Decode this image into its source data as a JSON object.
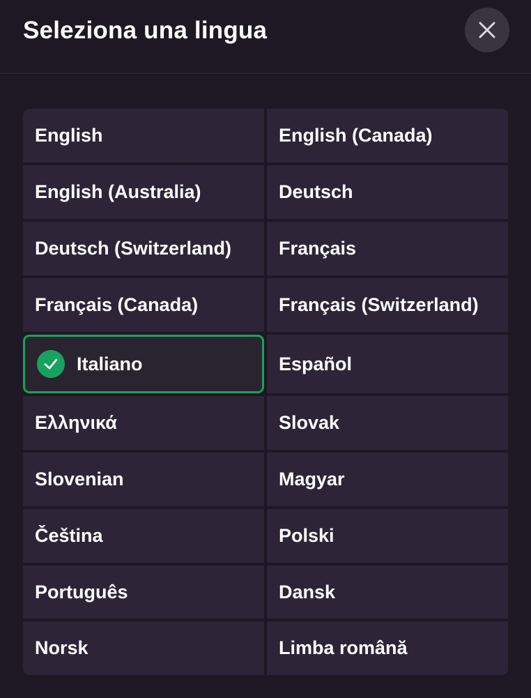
{
  "header": {
    "title": "Seleziona una lingua"
  },
  "languages": [
    {
      "label": "English"
    },
    {
      "label": "English (Canada)"
    },
    {
      "label": "English (Australia)"
    },
    {
      "label": "Deutsch"
    },
    {
      "label": "Deutsch (Switzerland)"
    },
    {
      "label": "Français"
    },
    {
      "label": "Français (Canada)"
    },
    {
      "label": "Français (Switzerland)"
    },
    {
      "label": "Italiano",
      "selected": true
    },
    {
      "label": "Español"
    },
    {
      "label": "Ελληνικά"
    },
    {
      "label": "Slovak"
    },
    {
      "label": "Slovenian"
    },
    {
      "label": "Magyar"
    },
    {
      "label": "Čeština"
    },
    {
      "label": "Polski"
    },
    {
      "label": "Português"
    },
    {
      "label": "Dansk"
    },
    {
      "label": "Norsk"
    },
    {
      "label": "Limba română"
    }
  ],
  "colors": {
    "background": "#1d1824",
    "cell": "#2d2437",
    "accent_green": "#19a15d",
    "close_button": "#3a3441"
  },
  "icons": {
    "close": "close-icon",
    "selected": "check-icon"
  }
}
